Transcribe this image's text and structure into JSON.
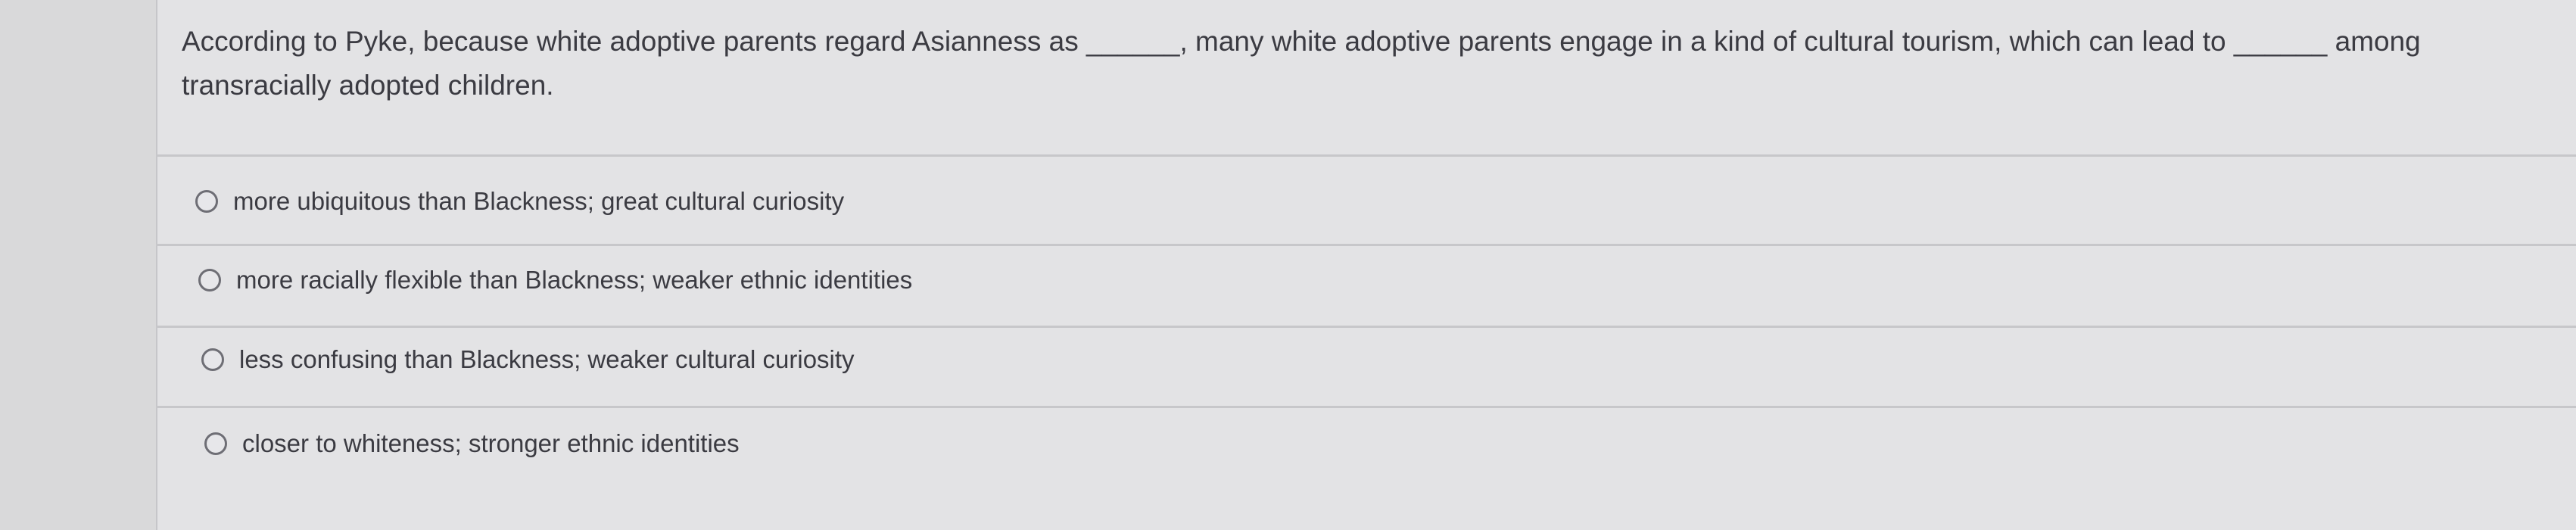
{
  "question": {
    "part1": "According to Pyke, because white adoptive parents regard Asianness as",
    "blank1": "______",
    "part2": ", many white adoptive parents engage in a kind of cultural tourism, which can lead to",
    "blank2": "______",
    "part3": "among transracially adopted children."
  },
  "options": [
    {
      "label": "more ubiquitous than Blackness; great cultural curiosity",
      "selected": false
    },
    {
      "label": "more racially flexible than Blackness; weaker ethnic identities",
      "selected": false
    },
    {
      "label": "less confusing than Blackness; weaker cultural curiosity",
      "selected": false
    },
    {
      "label": "closer to whiteness; stronger ethnic identities",
      "selected": false
    }
  ]
}
